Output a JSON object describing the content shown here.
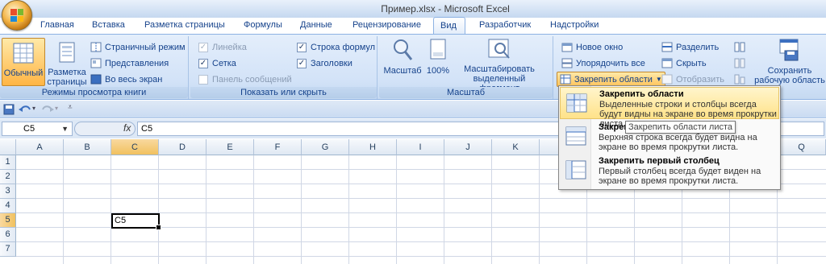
{
  "window": {
    "title": "Пример.xlsx - Microsoft Excel"
  },
  "tabs": [
    "Главная",
    "Вставка",
    "Разметка страницы",
    "Формулы",
    "Данные",
    "Рецензирование",
    "Вид",
    "Разработчик",
    "Надстройки"
  ],
  "active_tab": "Вид",
  "ribbon": {
    "views": {
      "label": "Режимы просмотра книги",
      "normal": "Обычный",
      "page_layout_1": "Разметка",
      "page_layout_2": "страницы",
      "page_break": "Страничный режим",
      "custom_views": "Представления",
      "full_screen": "Во весь экран"
    },
    "show_hide": {
      "label": "Показать или скрыть",
      "ruler": "Линейка",
      "gridlines": "Сетка",
      "message_bar": "Панель сообщений",
      "formula_bar": "Строка формул",
      "headings": "Заголовки",
      "ruler_checked": "✓",
      "gridlines_checked": "✓",
      "formula_bar_checked": "✓",
      "headings_checked": "✓"
    },
    "zoom": {
      "label": "Масштаб",
      "zoom": "Масштаб",
      "zoom100": "100%",
      "zoom_selection_1": "Масштабировать",
      "zoom_selection_2": "выделенный фрагмент"
    },
    "window": {
      "new_window": "Новое окно",
      "arrange_all": "Упорядочить все",
      "freeze_panes": "Закрепить области",
      "split": "Разделить",
      "hide": "Скрыть",
      "unhide": "Отобразить",
      "save_ws_1": "Сохранить",
      "save_ws_2": "рабочую область"
    }
  },
  "formula_bar": {
    "name_box": "C5",
    "fx": "fx",
    "content": "C5"
  },
  "columns": [
    "A",
    "B",
    "C",
    "D",
    "E",
    "F",
    "G",
    "H",
    "I",
    "J",
    "K",
    "L",
    "M",
    "N",
    "O",
    "P",
    "Q"
  ],
  "rows": [
    "1",
    "2",
    "3",
    "4",
    "5",
    "6",
    "7"
  ],
  "active_cell": {
    "ref": "C5",
    "value": "C5"
  },
  "freeze_menu": {
    "items": [
      {
        "title": "Закрепить области",
        "desc": "Выделенные строки и столбцы всегда будут видны на экране во время прокрутки листа."
      },
      {
        "title": "Закрепить верхнюю строку",
        "desc": "Верхняя строка всегда будет видна на экране во время прокрутки листа."
      },
      {
        "title": "Закрепить первый столбец",
        "desc": "Первый столбец всегда будет виден на экране во время прокрутки листа."
      }
    ],
    "item2_title_visible": "Закреп",
    "tooltip": "Закрепить области листа"
  },
  "colors": {
    "accent": "#15428b",
    "selected": "#f1c15f",
    "ribbon": "#d3e3f8"
  }
}
